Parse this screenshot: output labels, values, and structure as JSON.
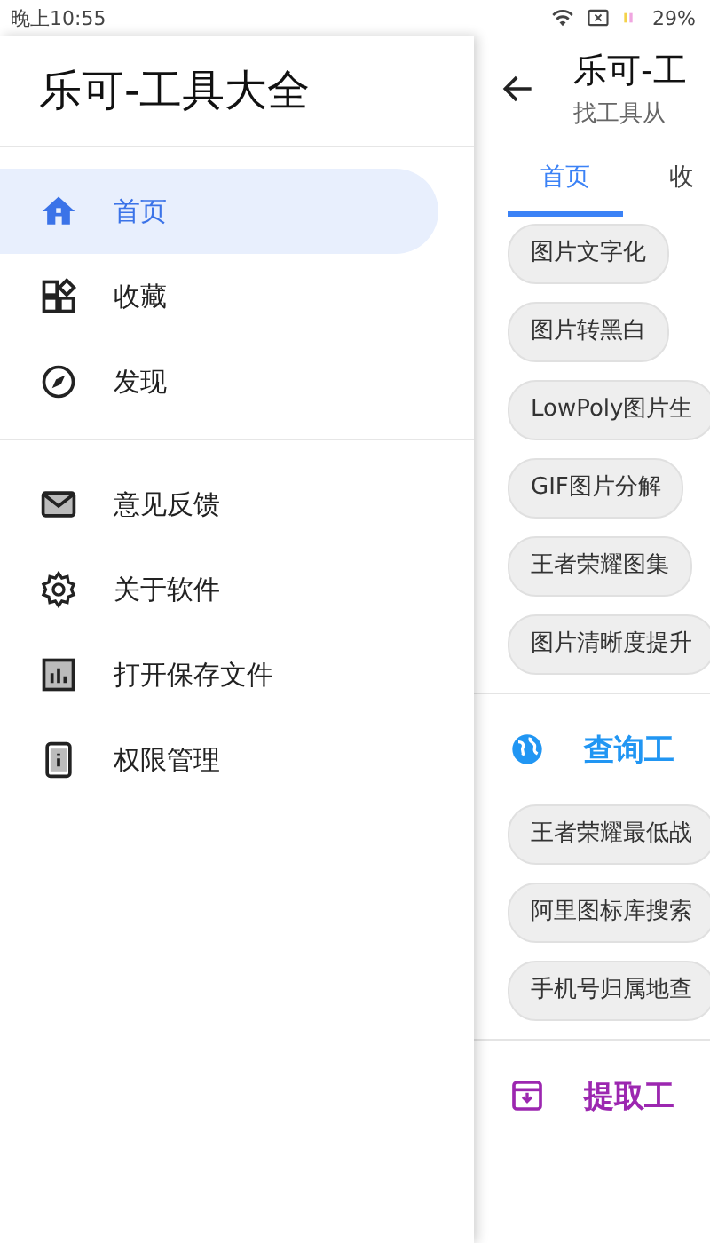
{
  "status_bar": {
    "time": "晚上10:55",
    "battery": "29%"
  },
  "drawer": {
    "title": "乐可-工具大全",
    "groups": [
      {
        "items": [
          {
            "label": "首页",
            "selected": true
          },
          {
            "label": "收藏",
            "selected": false
          },
          {
            "label": "发现",
            "selected": false
          }
        ]
      },
      {
        "items": [
          {
            "label": "意见反馈",
            "selected": false
          },
          {
            "label": "关于软件",
            "selected": false
          },
          {
            "label": "打开保存文件",
            "selected": false
          },
          {
            "label": "权限管理",
            "selected": false
          }
        ]
      }
    ]
  },
  "main": {
    "title": "乐可-工",
    "subtitle": "找工具从",
    "tabs": [
      {
        "label": "首页",
        "selected": true
      },
      {
        "label": "收",
        "selected": false
      }
    ],
    "sections": [
      {
        "chips": [
          "图片文字化",
          "图片转黑白",
          "LowPoly图片生",
          "GIF图片分解",
          "王者荣耀图集",
          "图片清晰度提升"
        ]
      },
      {
        "title": "查询工",
        "color": "#2196f3",
        "chips": [
          "王者荣耀最低战",
          "阿里图标库搜索",
          "手机号归属地查"
        ]
      },
      {
        "title": "提取工",
        "color": "#9c27b0"
      }
    ]
  }
}
